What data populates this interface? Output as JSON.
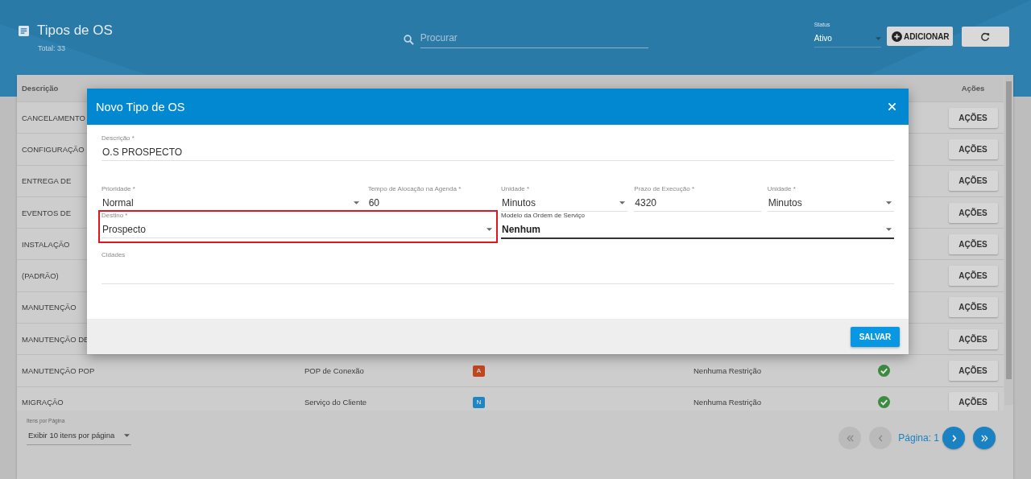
{
  "header": {
    "title": "Tipos de OS",
    "total": "Total: 33",
    "search": {
      "placeholder": "Procurar"
    },
    "status": {
      "label": "Status",
      "value": "Ativo"
    },
    "add_button": "ADICIONAR"
  },
  "table": {
    "columns": [
      "Descrição",
      "Ações"
    ],
    "rows": [
      {
        "descricao": "CANCELAMENTO",
        "acoes": "AÇÕES"
      },
      {
        "descricao": "CONFIGURAÇÃO",
        "acoes": "AÇÕES"
      },
      {
        "descricao": "ENTREGA DE",
        "acoes": "AÇÕES"
      },
      {
        "descricao": "EVENTOS DE",
        "acoes": "AÇÕES"
      },
      {
        "descricao": "INSTALAÇÃO",
        "acoes": "AÇÕES"
      },
      {
        "descricao": "(PADRÃO)",
        "acoes": "AÇÕES"
      },
      {
        "descricao": "MANUTENÇÃO",
        "acoes": "AÇÕES"
      },
      {
        "descricao": "MANUTENÇÃO DE",
        "acoes": "AÇÕES"
      },
      {
        "descricao": "MANUTENÇÃO POP",
        "destino": "POP de Conexão",
        "prioridade": {
          "letter": "A",
          "color": "#c0461f"
        },
        "cidades": "Nenhuma Restrição",
        "ativo": true,
        "acoes": "AÇÕES"
      },
      {
        "descricao": "MIGRAÇÃO",
        "destino": "Serviço do Cliente",
        "prioridade": {
          "letter": "N",
          "color": "#1f86c4"
        },
        "cidades": "Nenhuma Restrição",
        "ativo": true,
        "acoes": "AÇÕES"
      }
    ]
  },
  "pagination": {
    "items_label": "Itens por Página",
    "items_value": "Exibir 10 itens por página",
    "page_label": "Página: 1",
    "buttons": [
      {
        "kind": "first",
        "disabled": true
      },
      {
        "kind": "prev",
        "disabled": true
      },
      {
        "kind": "next",
        "disabled": false
      },
      {
        "kind": "last",
        "disabled": false
      }
    ]
  },
  "modal": {
    "title": "Novo Tipo de OS",
    "save_button": "SALVAR",
    "rows": [
      {
        "fields": [
          {
            "kind": "text",
            "label": "Descrição *",
            "value": "O.S PROSPECTO",
            "highlighted": false,
            "focused": false
          }
        ]
      },
      {
        "fields": [
          {
            "kind": "select",
            "label": "Prioridade *",
            "value": "Normal",
            "highlighted": false,
            "focused": false
          },
          {
            "kind": "text",
            "label": "Tempo de Alocação na Agenda *",
            "value": "60",
            "highlighted": false,
            "focused": false
          },
          {
            "kind": "select",
            "label": "Unidade *",
            "value": "Minutos",
            "highlighted": false,
            "focused": false
          },
          {
            "kind": "text",
            "label": "Prazo de Execução *",
            "value": "4320",
            "highlighted": false,
            "focused": false
          },
          {
            "kind": "select",
            "label": "Unidade *",
            "value": "Minutos",
            "highlighted": false,
            "focused": false
          }
        ]
      },
      {
        "fields": [
          {
            "kind": "select",
            "label": "Destino *",
            "value": "Prospecto",
            "highlighted": true,
            "focused": false
          },
          {
            "kind": "select",
            "label": "Modelo da Ordem de Serviço",
            "value": "Nenhum",
            "highlighted": false,
            "focused": true
          }
        ]
      },
      {
        "fields": [
          {
            "kind": "multi",
            "label": "Cidades",
            "highlighted": false,
            "focused": false
          }
        ]
      }
    ]
  }
}
